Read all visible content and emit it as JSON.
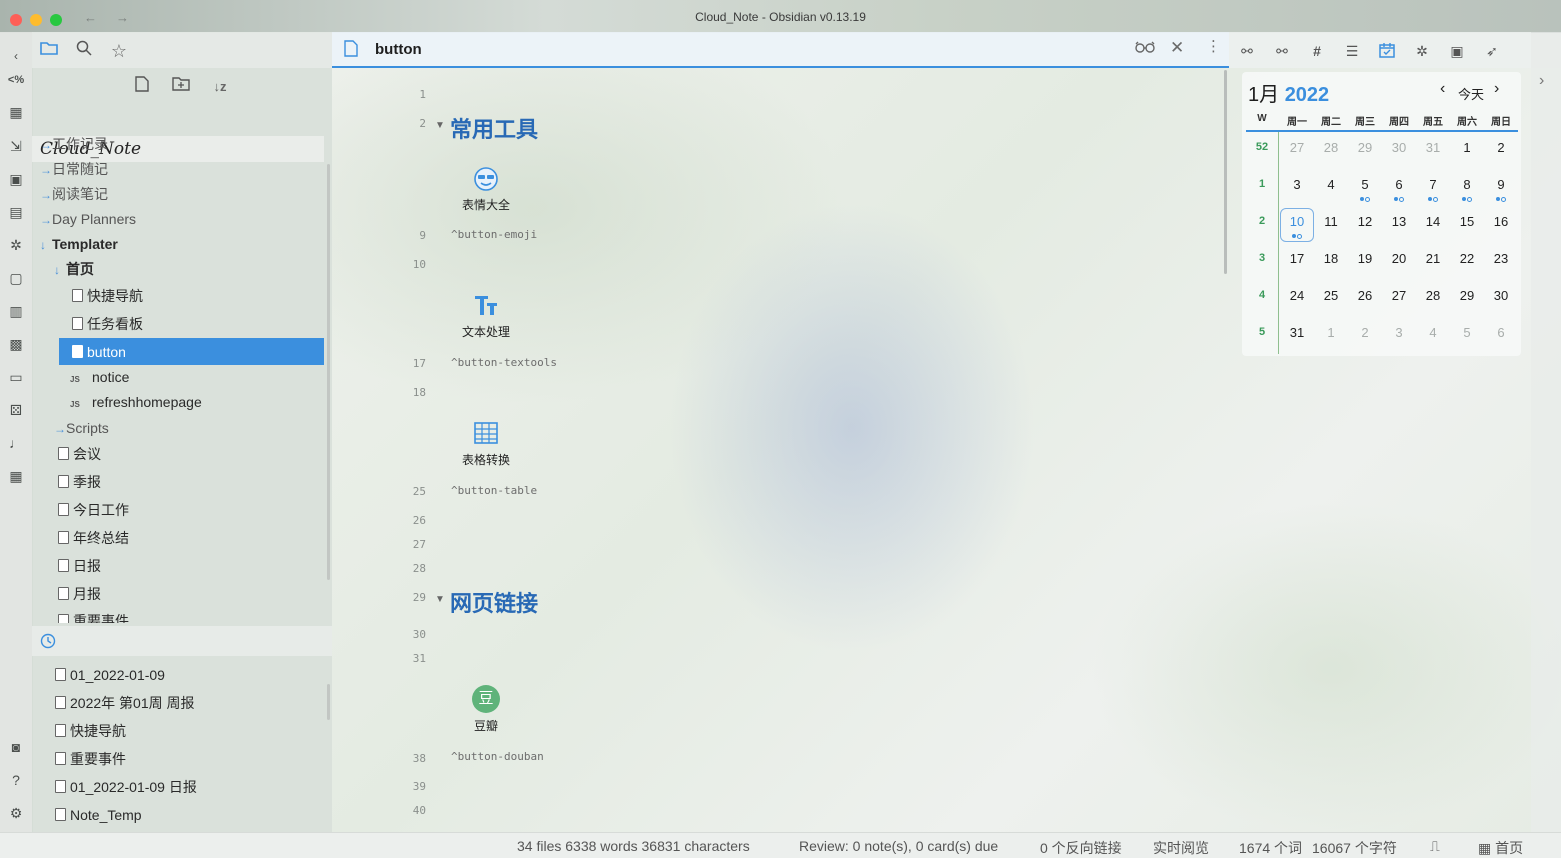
{
  "window": {
    "title": "Cloud_Note - Obsidian v0.13.19"
  },
  "sidebar": {
    "vault_name": "Cloud_Note",
    "tree": [
      {
        "label": "工作记录",
        "type": "folder"
      },
      {
        "label": "日常随记",
        "type": "folder"
      },
      {
        "label": "阅读笔记",
        "type": "folder"
      },
      {
        "label": "Day Planners",
        "type": "folder"
      },
      {
        "label": "Templater",
        "type": "folder-open"
      },
      {
        "label": "首页",
        "type": "folder-open"
      },
      {
        "label": "快捷导航",
        "type": "file"
      },
      {
        "label": "任务看板",
        "type": "file"
      },
      {
        "label": "button",
        "type": "file",
        "selected": true
      },
      {
        "label": "notice",
        "type": "js"
      },
      {
        "label": "refreshhomepage",
        "type": "js"
      },
      {
        "label": "Scripts",
        "type": "folder"
      },
      {
        "label": "会议",
        "type": "file"
      },
      {
        "label": "季报",
        "type": "file"
      },
      {
        "label": "今日工作",
        "type": "file"
      },
      {
        "label": "年终总结",
        "type": "file"
      },
      {
        "label": "日报",
        "type": "file"
      },
      {
        "label": "月报",
        "type": "file"
      },
      {
        "label": "重要事件",
        "type": "file"
      }
    ],
    "recent": [
      "01_2022-01-09",
      "2022年 第01周 周报",
      "快捷导航",
      "重要事件",
      "01_2022-01-09 日报",
      "Note_Temp"
    ],
    "js_badge": "JS"
  },
  "editor": {
    "title": "button",
    "line_numbers": [
      "1",
      "2",
      "9",
      "10",
      "17",
      "18",
      "25",
      "26",
      "27",
      "28",
      "29",
      "30",
      "31",
      "38",
      "39",
      "40"
    ],
    "headings": [
      "常用工具",
      "网页链接"
    ],
    "buttons": [
      {
        "label": "表情大全",
        "ref": "^button-emoji",
        "icon": "emoji-icon"
      },
      {
        "label": "文本处理",
        "ref": "^button-textools",
        "icon": "text-icon"
      },
      {
        "label": "表格转换",
        "ref": "^button-table",
        "icon": "table-icon"
      },
      {
        "label": "豆瓣",
        "ref": "^button-douban",
        "icon": "douban-icon",
        "icon_glyph": "豆"
      }
    ]
  },
  "calendar": {
    "month": "1月",
    "year": "2022",
    "today_label": "今天",
    "week_header": "W",
    "weekdays": [
      "周一",
      "周二",
      "周三",
      "周四",
      "周五",
      "周六",
      "周日"
    ],
    "weeks": [
      {
        "wk": "52",
        "days": [
          "27",
          "28",
          "29",
          "30",
          "31",
          "1",
          "2"
        ]
      },
      {
        "wk": "1",
        "days": [
          "3",
          "4",
          "5",
          "6",
          "7",
          "8",
          "9"
        ]
      },
      {
        "wk": "2",
        "days": [
          "10",
          "11",
          "12",
          "13",
          "14",
          "15",
          "16"
        ]
      },
      {
        "wk": "3",
        "days": [
          "17",
          "18",
          "19",
          "20",
          "21",
          "22",
          "23"
        ]
      },
      {
        "wk": "4",
        "days": [
          "24",
          "25",
          "26",
          "27",
          "28",
          "29",
          "30"
        ]
      },
      {
        "wk": "5",
        "days": [
          "31",
          "1",
          "2",
          "3",
          "4",
          "5",
          "6"
        ]
      }
    ],
    "accent": "#3b8fde"
  },
  "statusbar": {
    "stats": "34 files 6338 words 36831 characters",
    "review": "Review: 0 note(s), 0 card(s) due",
    "backlinks": "0 个反向链接",
    "mode": "实时阅览",
    "words": "1674 个词",
    "chars": "16067 个字符",
    "home": "首页"
  },
  "ribbon_toggle": "<%"
}
